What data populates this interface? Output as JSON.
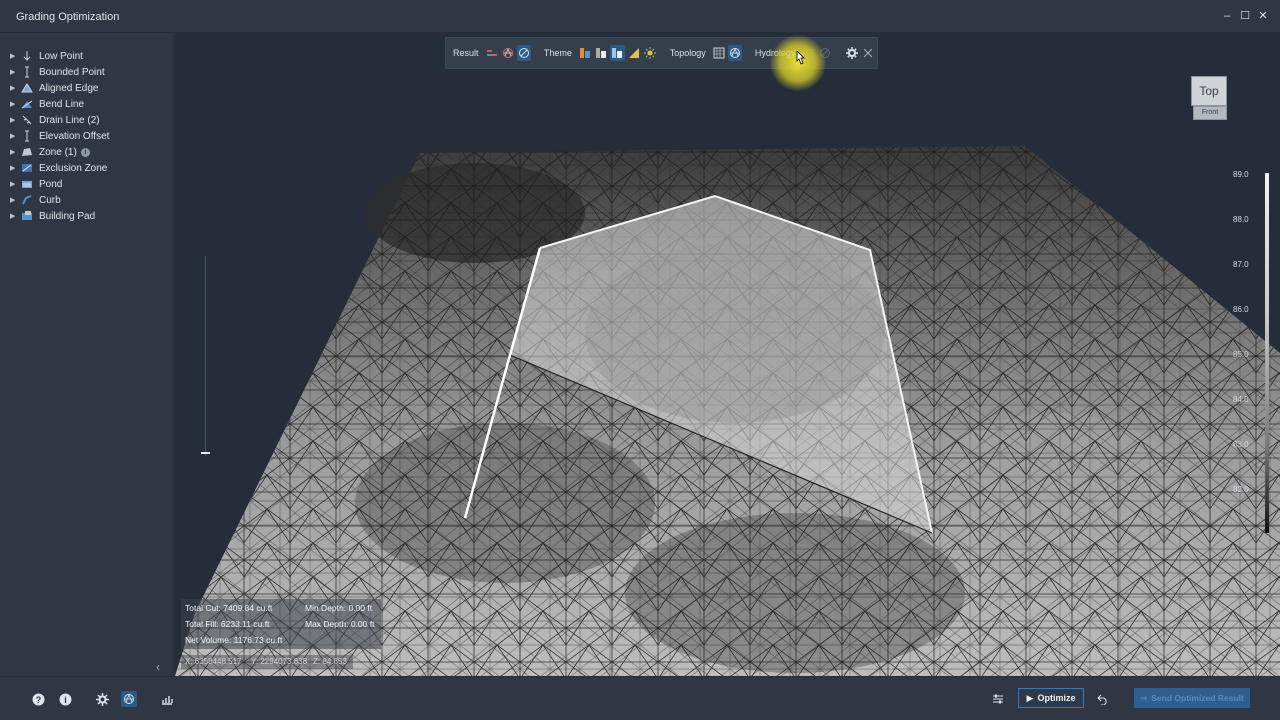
{
  "window": {
    "title": "Grading Optimization"
  },
  "sidebar": {
    "items": [
      {
        "label": "Low Point",
        "icon": "low-point-icon"
      },
      {
        "label": "Bounded Point",
        "icon": "bounded-point-icon"
      },
      {
        "label": "Aligned Edge",
        "icon": "aligned-edge-icon"
      },
      {
        "label": "Bend Line",
        "icon": "bend-line-icon"
      },
      {
        "label": "Drain Line (2)",
        "icon": "drain-line-icon"
      },
      {
        "label": "Elevation Offset",
        "icon": "elevation-offset-icon"
      },
      {
        "label": "Zone (1)",
        "icon": "zone-icon"
      },
      {
        "label": "Exclusion Zone",
        "icon": "exclusion-zone-icon"
      },
      {
        "label": "Pond",
        "icon": "pond-icon"
      },
      {
        "label": "Curb",
        "icon": "curb-icon"
      },
      {
        "label": "Building Pad",
        "icon": "building-pad-icon"
      }
    ]
  },
  "toolbar": {
    "result_label": "Result",
    "theme_label": "Theme",
    "topology_label": "Topology",
    "hydrology_label": "Hydrology"
  },
  "viewcube": {
    "top": "Top",
    "front": "Front"
  },
  "scale": {
    "ticks": [
      "89.0",
      "88.0",
      "87.0",
      "86.0",
      "85.0",
      "84.0",
      "83.0",
      "82.0"
    ]
  },
  "stats": {
    "total_cut": "Total Cut: 7409.84 cu.ft",
    "total_fill": "Total Fill: 6233.11 cu.ft",
    "net_volume": "Net Volume: 1176.73 cu.ft",
    "min_depth": "Min Depth: 0.00 ft",
    "max_depth": "Max Depth: 0.00 ft"
  },
  "coords": {
    "x": "X: 6358448.517",
    "y": "Y: 2294073.838",
    "z": "Z: 84.853"
  },
  "bottom": {
    "optimize_label": "Optimize",
    "send_label": "Send Optimized Result"
  },
  "colors": {
    "accent": "#2f5f8e",
    "background": "#2b3340",
    "highlight": "#e8dc3a"
  }
}
